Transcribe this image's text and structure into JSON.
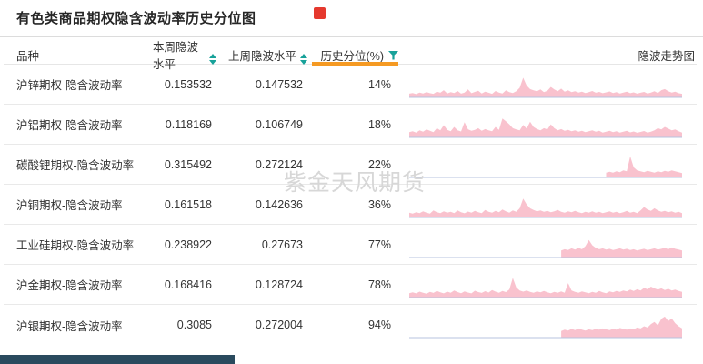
{
  "title": "有色类商品期权隐含波动率历史分位图",
  "watermark": "紫金天风期货",
  "colors": {
    "accent_orange": "#F59A23",
    "sort_teal": "#18A29A",
    "spark_fill": "#F9C2CE",
    "spark_baseline": "#B7C3DF",
    "watermark": "#D7D7D7",
    "red_marker": "#E5392E",
    "bottom_bar": "#2A4A5E"
  },
  "table": {
    "columns": [
      {
        "label": "品种"
      },
      {
        "label": "本周隐波水平",
        "sortable": true
      },
      {
        "label": "上周隐波水平",
        "sortable": true
      },
      {
        "label": "历史分位(%)",
        "filter": true,
        "active": true
      },
      {
        "label": "隐波走势图"
      }
    ],
    "rows": [
      {
        "name": "沪锌期权-隐含波动率",
        "this_week": "0.153532",
        "last_week": "0.147532",
        "percentile": "14%",
        "spark": [
          15,
          18,
          13,
          20,
          16,
          22,
          17,
          14,
          24,
          19,
          31,
          16,
          22,
          18,
          27,
          15,
          20,
          34,
          17,
          23,
          28,
          16,
          24,
          19,
          14,
          27,
          20,
          16,
          30,
          22,
          18,
          26,
          42,
          88,
          52,
          36,
          30,
          26,
          34,
          22,
          28,
          46,
          34,
          26,
          38,
          24,
          30,
          22,
          26,
          20,
          24,
          18,
          22,
          27,
          19,
          23,
          17,
          21,
          25,
          18,
          22,
          16,
          20,
          24,
          17,
          21,
          15,
          19,
          23,
          16,
          20,
          26,
          18,
          31,
          36,
          26,
          20,
          24,
          17,
          14
        ]
      },
      {
        "name": "沪铝期权-隐含波动率",
        "this_week": "0.118169",
        "last_week": "0.106749",
        "percentile": "18%",
        "spark": [
          22,
          26,
          20,
          30,
          24,
          34,
          28,
          22,
          40,
          30,
          54,
          32,
          26,
          46,
          30,
          25,
          68,
          35,
          28,
          32,
          40,
          28,
          36,
          30,
          26,
          46,
          32,
          84,
          72,
          58,
          40,
          34,
          30,
          55,
          38,
          70,
          46,
          36,
          30,
          40,
          34,
          58,
          40,
          30,
          36,
          28,
          32,
          26,
          30,
          24,
          28,
          22,
          26,
          30,
          24,
          28,
          20,
          24,
          28,
          22,
          26,
          20,
          24,
          28,
          21,
          25,
          19,
          23,
          27,
          20,
          24,
          30,
          40,
          34,
          46,
          38,
          30,
          34,
          26,
          20
        ]
      },
      {
        "name": "碳酸锂期权-隐含波动率",
        "this_week": "0.315492",
        "last_week": "0.272124",
        "percentile": "22%",
        "spark": [
          null,
          null,
          null,
          null,
          null,
          null,
          null,
          null,
          null,
          null,
          null,
          null,
          null,
          null,
          null,
          null,
          null,
          null,
          null,
          null,
          null,
          null,
          null,
          null,
          null,
          null,
          null,
          null,
          null,
          null,
          null,
          null,
          null,
          null,
          null,
          null,
          null,
          null,
          null,
          null,
          null,
          null,
          null,
          null,
          null,
          null,
          null,
          null,
          null,
          null,
          null,
          null,
          null,
          null,
          null,
          null,
          null,
          20,
          24,
          20,
          26,
          22,
          30,
          26,
          95,
          44,
          30,
          26,
          22,
          28,
          24,
          20,
          26,
          22,
          28,
          24,
          30,
          26,
          22,
          18
        ]
      },
      {
        "name": "沪铜期权-隐含波动率",
        "this_week": "0.161518",
        "last_week": "0.142636",
        "percentile": "36%",
        "spark": [
          20,
          16,
          22,
          18,
          26,
          20,
          16,
          30,
          22,
          18,
          26,
          20,
          24,
          18,
          30,
          22,
          17,
          25,
          20,
          28,
          22,
          18,
          32,
          24,
          20,
          28,
          22,
          34,
          26,
          20,
          30,
          24,
          40,
          84,
          58,
          40,
          32,
          26,
          30,
          24,
          28,
          22,
          26,
          32,
          24,
          20,
          26,
          22,
          28,
          22,
          18,
          24,
          20,
          26,
          20,
          24,
          18,
          22,
          26,
          20,
          24,
          18,
          22,
          28,
          20,
          24,
          18,
          30,
          46,
          34,
          28,
          40,
          30,
          24,
          28,
          22,
          26,
          20,
          24,
          18
        ]
      },
      {
        "name": "工业硅期权-隐含波动率",
        "this_week": "0.238922",
        "last_week": "0.27673",
        "percentile": "77%",
        "spark": [
          null,
          null,
          null,
          null,
          null,
          null,
          null,
          null,
          null,
          null,
          null,
          null,
          null,
          null,
          null,
          null,
          null,
          null,
          null,
          null,
          null,
          null,
          null,
          null,
          null,
          null,
          null,
          null,
          null,
          null,
          null,
          null,
          null,
          null,
          null,
          null,
          null,
          null,
          null,
          null,
          null,
          null,
          null,
          null,
          30,
          36,
          32,
          40,
          34,
          42,
          36,
          50,
          78,
          54,
          42,
          36,
          40,
          34,
          38,
          32,
          36,
          40,
          34,
          38,
          32,
          36,
          30,
          34,
          38,
          32,
          36,
          40,
          34,
          38,
          42,
          36,
          44,
          38,
          34,
          30
        ]
      },
      {
        "name": "沪金期权-隐含波动率",
        "this_week": "0.168416",
        "last_week": "0.128724",
        "percentile": "78%",
        "spark": [
          18,
          22,
          17,
          25,
          20,
          16,
          24,
          19,
          28,
          22,
          17,
          25,
          20,
          30,
          23,
          18,
          26,
          21,
          17,
          29,
          23,
          19,
          27,
          21,
          32,
          25,
          20,
          28,
          23,
          35,
          88,
          44,
          30,
          25,
          30,
          24,
          20,
          26,
          22,
          28,
          22,
          18,
          24,
          20,
          26,
          20,
          64,
          30,
          24,
          20,
          26,
          22,
          18,
          24,
          20,
          28,
          22,
          18,
          26,
          22,
          28,
          24,
          30,
          26,
          34,
          28,
          36,
          30,
          42,
          36,
          48,
          40,
          34,
          40,
          32,
          38,
          30,
          34,
          28,
          24
        ]
      },
      {
        "name": "沪银期权-隐含波动率",
        "this_week": "0.3085",
        "last_week": "0.272004",
        "percentile": "94%",
        "spark": [
          null,
          null,
          null,
          null,
          null,
          null,
          null,
          null,
          null,
          null,
          null,
          null,
          null,
          null,
          null,
          null,
          null,
          null,
          null,
          null,
          null,
          null,
          null,
          null,
          null,
          null,
          null,
          null,
          null,
          null,
          null,
          null,
          null,
          null,
          null,
          null,
          null,
          null,
          null,
          null,
          null,
          null,
          null,
          null,
          28,
          34,
          30,
          38,
          32,
          40,
          34,
          30,
          36,
          32,
          38,
          34,
          40,
          36,
          32,
          38,
          34,
          42,
          38,
          34,
          40,
          36,
          44,
          40,
          50,
          44,
          60,
          70,
          54,
          84,
          94,
          74,
          86,
          64,
          50,
          40
        ]
      }
    ]
  }
}
